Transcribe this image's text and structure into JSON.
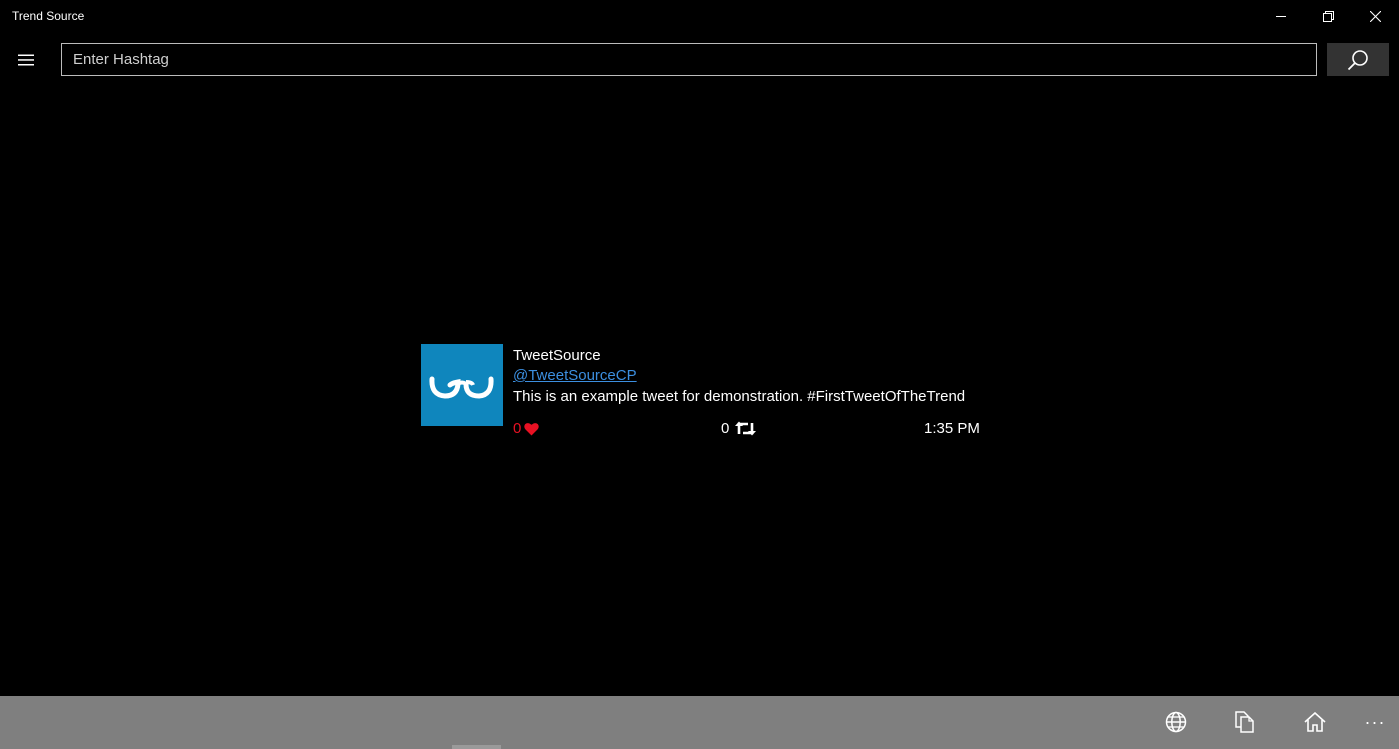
{
  "window": {
    "title": "Trend Source",
    "controls": {
      "minimize_icon": "minimize-icon",
      "restore_icon": "restore-icon",
      "close_icon": "close-icon"
    }
  },
  "toolbar": {
    "menu_icon": "hamburger-menu-icon",
    "search_placeholder": "Enter Hashtag",
    "search_value": "",
    "search_icon": "search-icon"
  },
  "tweet": {
    "display_name": "TweetSource",
    "handle": "@TweetSourceCP",
    "text": "This is an example tweet for demonstration. #FirstTweetOfTheTrend",
    "likes": "0",
    "retweets": "0",
    "time": "1:35 PM",
    "avatar_icon": "glasses-logo-icon",
    "like_icon": "heart-icon",
    "retweet_icon": "retweet-icon"
  },
  "app_bar": {
    "buttons": [
      "globe-icon",
      "copy-icon",
      "home-icon"
    ],
    "more_label": "···"
  },
  "colors": {
    "background": "#000000",
    "app_bar": "#7f7f7f",
    "avatar": "#0f86bd",
    "handle_link": "#3c8fe0",
    "like_red": "#e81123",
    "search_button": "#333333"
  }
}
